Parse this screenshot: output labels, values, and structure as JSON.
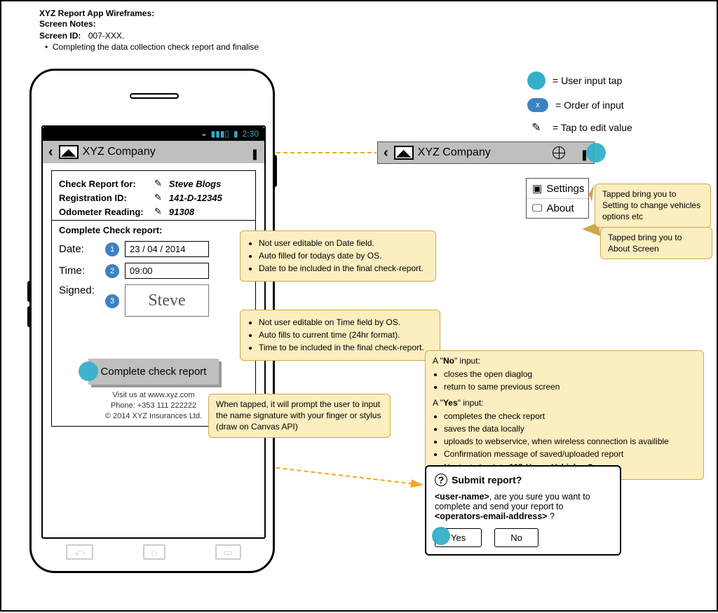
{
  "header": {
    "l1": "XYZ Report App Wireframes:",
    "l2": "Screen Notes:",
    "l3a": "Screen ID:",
    "l3b": "007-XXX.",
    "bullet": "Completing the data collection check report and finalise"
  },
  "phone": {
    "status_time": "2:30",
    "title": "XYZ Company",
    "card": {
      "label_for": "Check Report for:",
      "val_for": "Steve Blogs",
      "label_reg": "Registration ID:",
      "val_reg": "141-D-12345",
      "label_odo": "Odometer Reading:",
      "val_odo": "91308",
      "section": "Complete Check report:"
    },
    "fields": {
      "date_label": "Date:",
      "date_value": "23 / 04 / 2014",
      "time_label": "Time:",
      "time_value": "09:00",
      "signed_label": "Signed:",
      "signed_value": "Steve",
      "order1": "1",
      "order2": "2",
      "order3": "3"
    },
    "button": "Complete check report",
    "footer": {
      "l1": "Visit us at www.xyz.com",
      "l2": "Phone: +353 111 222222",
      "l3": "© 2014 XYZ Insurances Ltd."
    }
  },
  "legend": {
    "l1": "= User input tap",
    "l2": "= Order of input",
    "l2x": "x",
    "l3": "= Tap to edit value"
  },
  "bar2": {
    "title": "XYZ Company",
    "menu_settings": "Settings",
    "menu_about": "About"
  },
  "callouts": {
    "date": {
      "b1": "Not user editable on Date field.",
      "b2": "Auto filled for todays date by OS.",
      "b3": "Date to be included in the final check-report."
    },
    "time": {
      "b1": "Not user editable on Time field by OS.",
      "b2": "Auto fills to current time (24hr format).",
      "b3": "Time to be included in the final check-report."
    },
    "sig": "When tapped, it will prompt the user to input the name signature with your finger or stylus (draw on Canvas API)",
    "settings": "Tapped bring you to Setting to change vehicles options etc",
    "about": "Tapped bring you to About Screen",
    "submit": {
      "no_h": "A \"No\" input:",
      "no_b1": "closes the open diaglog",
      "no_b2": "return to same previous screen",
      "yes_h": "A \"Yes\" input:",
      "yes_b1": "completes the check report",
      "yes_b2": "saves the data locally",
      "yes_b3": "uploads to webservice, when wireless connection is availible",
      "yes_b4": "Confirmation message of saved/uploaded report",
      "yes_b5": "Navigate back to 005-Home Vehicles Screen."
    }
  },
  "dialog": {
    "title": "Submit report?",
    "body1a": "<user-name>",
    "body1b": ", are you sure you want to complete and send your report to",
    "body2": "<operators-email-address>",
    "body2b": " ?",
    "yes": "Yes",
    "no": "No"
  }
}
